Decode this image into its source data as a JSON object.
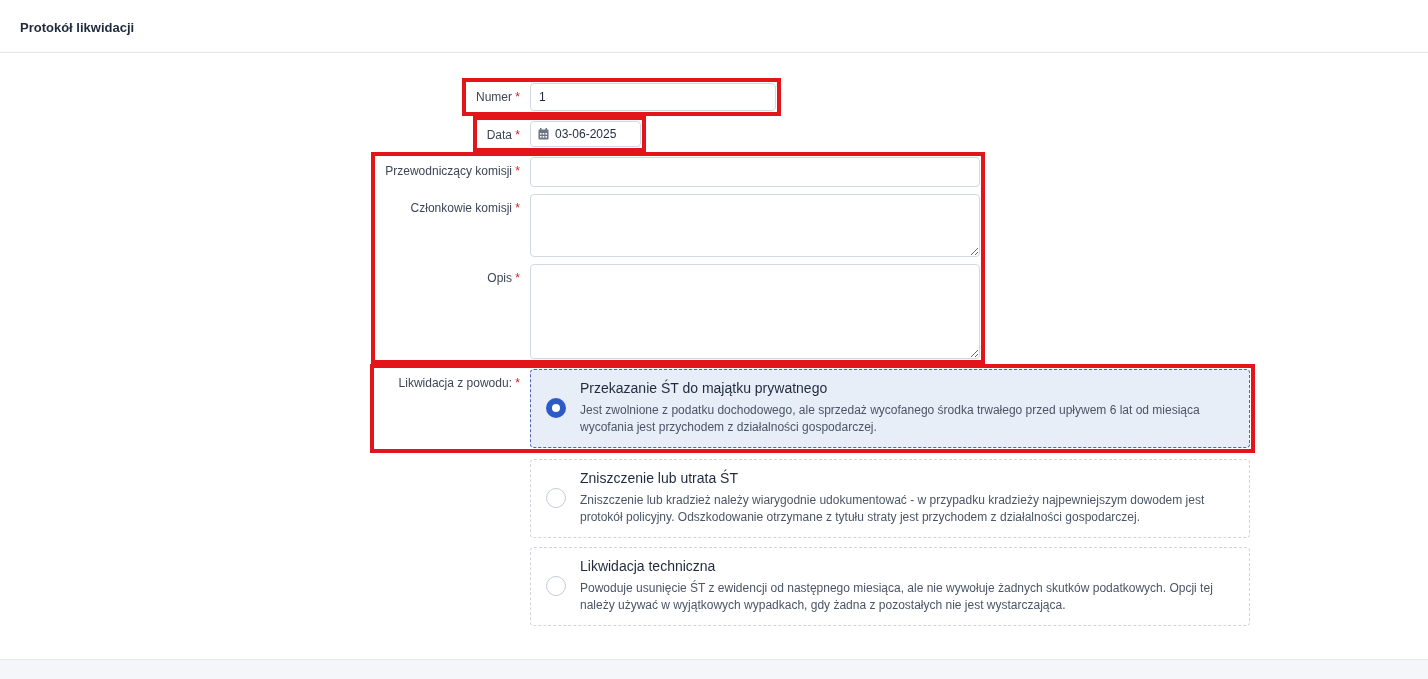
{
  "header": {
    "title": "Protokół likwidacji"
  },
  "sections": [
    {
      "highlighted": true,
      "fields": [
        {
          "kind": "text",
          "label": "Numer",
          "mark": "*",
          "value": "1"
        }
      ]
    },
    {
      "highlighted": true,
      "fields": [
        {
          "kind": "date",
          "label": "Data",
          "mark": "*",
          "value": "03-06-2025"
        }
      ]
    },
    {
      "highlighted": true,
      "fields": [
        {
          "kind": "text",
          "label": "Przewodniczący komisji",
          "mark": "*"
        },
        {
          "kind": "textarea",
          "label": "Członkowie komisji",
          "mark": "*"
        },
        {
          "kind": "textarea-tall",
          "label": "Opis",
          "mark": "*"
        }
      ]
    },
    {
      "highlighted": true,
      "fields": [
        {
          "kind": "radio",
          "label": "Likwidacja z powodu:",
          "mark": "*",
          "options": [
            {
              "title": "Przekazanie ŚT do majątku prywatnego",
              "description": "Jest zwolnione z podatku dochodowego, ale sprzedaż wycofanego środka trwałego przed upływem 6 lat od miesiąca wycofania jest przychodem z działalności gospodarczej.",
              "selected": true
            },
            {
              "title": "Zniszczenie lub utrata ŚT",
              "description": "Zniszczenie lub kradzież należy wiarygodnie udokumentować - w przypadku kradzieży najpewniejszym dowodem jest protokół policyjny. Odszkodowanie otrzymane z tytułu straty jest przychodem z działalności gospodarczej.",
              "selected": false
            },
            {
              "title": "Likwidacja techniczna",
              "description": "Powoduje usunięcie ŚT z ewidencji od następnego miesiąca, ale nie wywołuje żadnych skutków podatkowych. Opcji tej należy używać w wyjątkowych wypadkach, gdy żadna z pozostałych nie jest wystarczająca.",
              "selected": false
            }
          ]
        }
      ]
    }
  ]
}
